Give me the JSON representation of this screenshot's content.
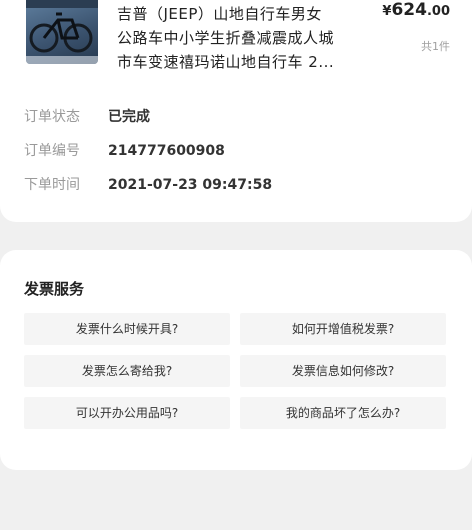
{
  "order": {
    "product_image": "folding-bike-thumbnail",
    "title_lines": [
      "吉普（JEEP）山地自行车男女",
      "公路车中小学生折叠减震成人城",
      "市车变速禧玛诺山地自行车 2..."
    ],
    "price_currency": "¥",
    "price_int": "624",
    "price_dec": ".00",
    "quantity": "共1件",
    "status_label": "订单状态",
    "status_value": "已完成",
    "number_label": "订单编号",
    "number_value": "214777600908",
    "time_label": "下单时间",
    "time_value": "2021-07-23 09:47:58"
  },
  "invoice": {
    "title": "发票服务",
    "questions": [
      "发票什么时候开具?",
      "如何开增值税发票?",
      "发票怎么寄给我?",
      "发票信息如何修改?",
      "可以开办公用品吗?",
      "我的商品坏了怎么办?"
    ]
  }
}
